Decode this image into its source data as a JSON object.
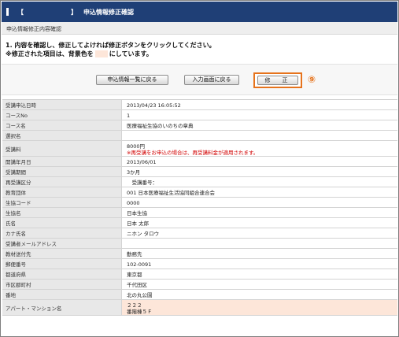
{
  "header": {
    "bracket_open": "【",
    "bracket_close": "】",
    "title": "申込情報修正確認"
  },
  "section": {
    "title": "申込情報修正内容確認"
  },
  "instructions": {
    "line1": "1. 内容を確認し、修正してよければ修正ボタンをクリックしてください。",
    "line2_pre": "※修正された項目は、背景色を",
    "line2_post": "にしています。"
  },
  "buttons": {
    "list_back": "申込情報一覧に戻る",
    "input_back": "入力画面に戻る",
    "fix": "修　正",
    "badge": "⑨"
  },
  "colors": {
    "header_bg": "#1f3f76",
    "highlight": "#fde6d9",
    "badge": "#e6731c"
  },
  "rows": [
    {
      "label": "受講申込日時",
      "value": "2013/04/23 16:05:52"
    },
    {
      "label": "コースNo",
      "value": "1"
    },
    {
      "label": "コース名",
      "value": "医療福祉生協のいのちの章典"
    },
    {
      "label": "選択名",
      "value": ""
    },
    {
      "label": "受講料",
      "value": "8000円",
      "note": "※再受講をお申込の場合は、再受講料金が適用されます。"
    },
    {
      "label": "開講年月日",
      "value": "2013/06/01"
    },
    {
      "label": "受講期間",
      "value": "3か月"
    },
    {
      "label": "再受講区分",
      "value": "　受講番号："
    },
    {
      "label": "教育団体",
      "value": "001  日本医療福祉生活協同組合連合会"
    },
    {
      "label": "生協コード",
      "value": "0000"
    },
    {
      "label": "生協名",
      "value": "日本生協"
    },
    {
      "label": "氏名",
      "value": "日本  太郎"
    },
    {
      "label": "カナ氏名",
      "value": "ニホン  タロウ"
    },
    {
      "label": "受講者メールアドレス",
      "value": ""
    },
    {
      "label": "教材送付先",
      "value": "勤務先"
    },
    {
      "label": "郵便番号",
      "value": "102-0091"
    },
    {
      "label": "都道府県",
      "value": "東京都"
    },
    {
      "label": "市区郡町村",
      "value": "千代田区"
    },
    {
      "label": "番地",
      "value": "北の丸公園"
    },
    {
      "label": "アパート・マンション名",
      "value": "２２２",
      "value2": "番階棟５Ｆ",
      "highlight": true
    }
  ]
}
